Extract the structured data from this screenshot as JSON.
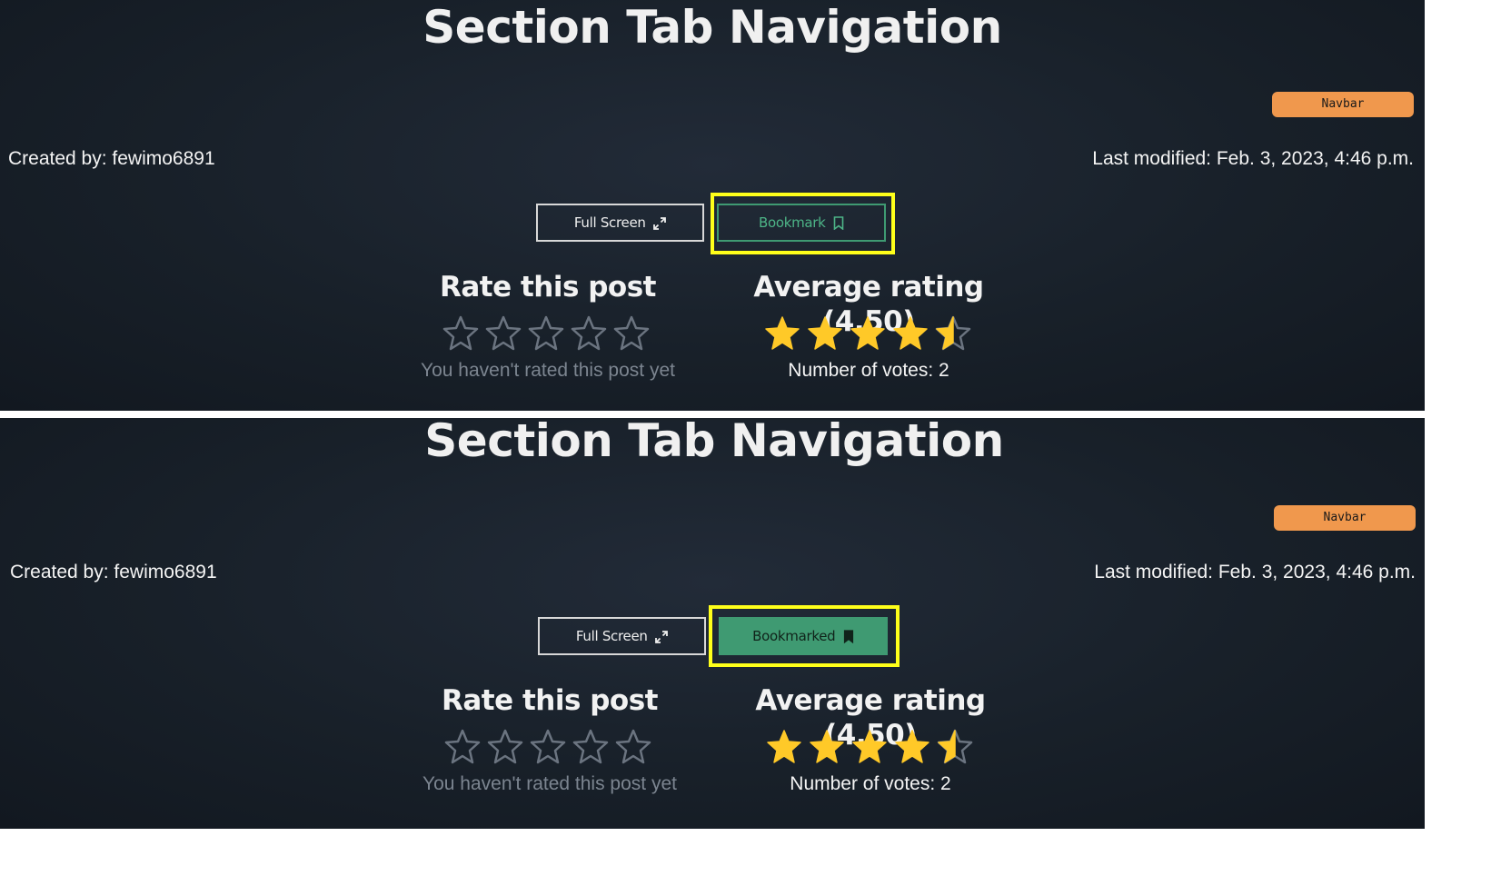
{
  "panels": [
    {
      "title": "Section Tab Navigation",
      "tag": "Navbar",
      "created_by": "Created by: fewimo6891",
      "last_modified": "Last modified: Feb. 3, 2023, 4:46 p.m.",
      "full_screen_label": "Full Screen",
      "bookmark_label": "Bookmark",
      "bookmark_state": "not-bookmarked",
      "rate_heading": "Rate this post",
      "user_rating": 0,
      "rate_caption": "You haven't rated this post yet",
      "avg_heading": "Average rating (4.50)",
      "avg_rating": 4.5,
      "votes_caption": "Number of votes: 2"
    },
    {
      "title": "Section Tab Navigation",
      "tag": "Navbar",
      "created_by": "Created by: fewimo6891",
      "last_modified": "Last modified: Feb. 3, 2023, 4:46 p.m.",
      "full_screen_label": "Full Screen",
      "bookmark_label": "Bookmarked",
      "bookmark_state": "bookmarked",
      "rate_heading": "Rate this post",
      "user_rating": 0,
      "rate_caption": "You haven't rated this post yet",
      "avg_heading": "Average rating (4.50)",
      "avg_rating": 4.5,
      "votes_caption": "Number of votes: 2"
    }
  ],
  "colors": {
    "background": "#182029",
    "tag": "#f0984d",
    "bookmark_green": "#3f9a72",
    "highlight": "#ffff1a",
    "star_filled": "#ffc928",
    "star_empty": "#6b7480"
  },
  "icons": {
    "full_screen": "expand-arrows-icon",
    "bookmark_outline": "bookmark-outline-icon",
    "bookmark_filled": "bookmark-filled-icon",
    "star": "star-icon"
  }
}
